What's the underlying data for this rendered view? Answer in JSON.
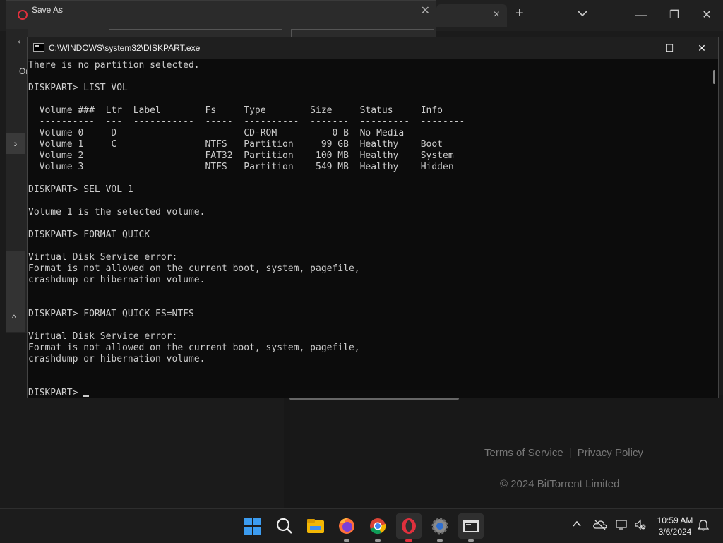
{
  "saveas": {
    "title": "Save As",
    "back_icon": "arrow-left-icon",
    "organize_label": "Or"
  },
  "browser": {
    "tab_close": "×",
    "new_tab": "+",
    "footer_terms": "Terms of Service",
    "footer_sep": "|",
    "footer_privacy": "Privacy Policy",
    "copyright": "© 2024 BitTorrent Limited"
  },
  "console": {
    "title": "C:\\WINDOWS\\system32\\DISKPART.exe",
    "lines": [
      "There is no partition selected.",
      "",
      "DISKPART> LIST VOL",
      "",
      "  Volume ###  Ltr  Label        Fs     Type        Size     Status     Info",
      "  ----------  ---  -----------  -----  ----------  -------  ---------  --------",
      "  Volume 0     D                       CD-ROM          0 B  No Media",
      "  Volume 1     C                NTFS   Partition     99 GB  Healthy    Boot",
      "  Volume 2                      FAT32  Partition    100 MB  Healthy    System",
      "  Volume 3                      NTFS   Partition    549 MB  Healthy    Hidden",
      "",
      "DISKPART> SEL VOL 1",
      "",
      "Volume 1 is the selected volume.",
      "",
      "DISKPART> FORMAT QUICK",
      "",
      "Virtual Disk Service error:",
      "Format is not allowed on the current boot, system, pagefile,",
      "crashdump or hibernation volume.",
      "",
      "",
      "DISKPART> FORMAT QUICK FS=NTFS",
      "",
      "Virtual Disk Service error:",
      "Format is not allowed on the current boot, system, pagefile,",
      "crashdump or hibernation volume.",
      "",
      "",
      "DISKPART> "
    ]
  },
  "taskbar": {
    "apps": [
      "windows-start-icon",
      "search-icon",
      "file-explorer-icon",
      "firefox-icon",
      "chrome-icon",
      "opera-icon",
      "settings-icon",
      "terminal-icon"
    ],
    "time": "10:59 AM",
    "date": "3/6/2024"
  }
}
